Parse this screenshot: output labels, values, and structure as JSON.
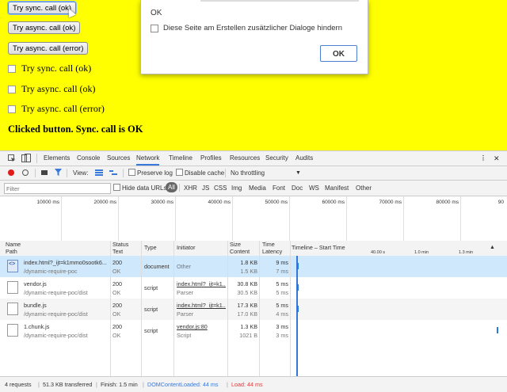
{
  "page": {
    "buttons": [
      "Try sync. call (ok)",
      "Try async. call (ok)",
      "Try async. call (error)"
    ],
    "checkboxes": [
      "Try sync. call (ok)",
      "Try async. call (ok)",
      "Try async. call (error)"
    ],
    "result": "Clicked button. Sync. call is OK"
  },
  "dialog": {
    "message": "OK",
    "suppress_label": "Diese Seite am Erstellen zusätzlicher Dialoge hindern",
    "ok_label": "OK"
  },
  "devtools": {
    "tabs": [
      "Elements",
      "Console",
      "Sources",
      "Network",
      "Timeline",
      "Profiles",
      "Resources",
      "Security",
      "Audits"
    ],
    "active_tab": "Network",
    "toolbar": {
      "view_label": "View:",
      "preserve_log": "Preserve log",
      "disable_cache": "Disable cache",
      "throttling": "No throttling"
    },
    "filter": {
      "placeholder": "Filter",
      "hide_data_urls": "Hide data URLs",
      "types": [
        "All",
        "XHR",
        "JS",
        "CSS",
        "Img",
        "Media",
        "Font",
        "Doc",
        "WS",
        "Manifest",
        "Other"
      ]
    },
    "overview_ticks": [
      "10000 ms",
      "20000 ms",
      "30000 ms",
      "40000 ms",
      "50000 ms",
      "60000 ms",
      "70000 ms",
      "80000 ms",
      "90"
    ],
    "columns": {
      "name": "Name",
      "path": "Path",
      "status": "Status",
      "text": "Text",
      "type": "Type",
      "initiator": "Initiator",
      "size": "Size",
      "content": "Content",
      "time": "Time",
      "latency": "Latency",
      "timeline": "Timeline – Start Time",
      "timeline_ticks": [
        "40.00 s",
        "1.0 min",
        "1.3 min"
      ]
    },
    "rows": [
      {
        "name": "index.html?_ijt=k1mmo0sootk6...",
        "path": "/dynamic-require-poc",
        "status": "200",
        "text": "OK",
        "type": "document",
        "initiator": "Other",
        "initiator_sub": "",
        "size": "1.8 KB",
        "content": "1.5 KB",
        "time": "9 ms",
        "latency": "7 ms"
      },
      {
        "name": "vendor.js",
        "path": "/dynamic-require-poc/dist",
        "status": "200",
        "text": "OK",
        "type": "script",
        "initiator": "index.html?_ijt=k1...",
        "initiator_sub": "Parser",
        "size": "30.8 KB",
        "content": "30.5 KB",
        "time": "5 ms",
        "latency": "5 ms"
      },
      {
        "name": "bundle.js",
        "path": "/dynamic-require-poc/dist",
        "status": "200",
        "text": "OK",
        "type": "script",
        "initiator": "index.html?_ijt=k1...",
        "initiator_sub": "Parser",
        "size": "17.3 KB",
        "content": "17.0 KB",
        "time": "5 ms",
        "latency": "4 ms"
      },
      {
        "name": "1.chunk.js",
        "path": "/dynamic-require-poc/dist",
        "status": "200",
        "text": "OK",
        "type": "script",
        "initiator": "vendor.js:80",
        "initiator_sub": "Script",
        "size": "1.3 KB",
        "content": "1021 B",
        "time": "3 ms",
        "latency": "3 ms"
      }
    ],
    "status": {
      "requests": "4 requests",
      "transferred": "51.3 KB transferred",
      "finish": "Finish: 1.5 min",
      "dcl": "DOMContentLoaded: 44 ms",
      "load": "Load: 44 ms"
    }
  },
  "colors": {
    "page_bg": "#ffff00",
    "accent": "#3879d9",
    "record": "#e21b1b",
    "dcl": "#3879d9",
    "load": "#e03a3a"
  }
}
